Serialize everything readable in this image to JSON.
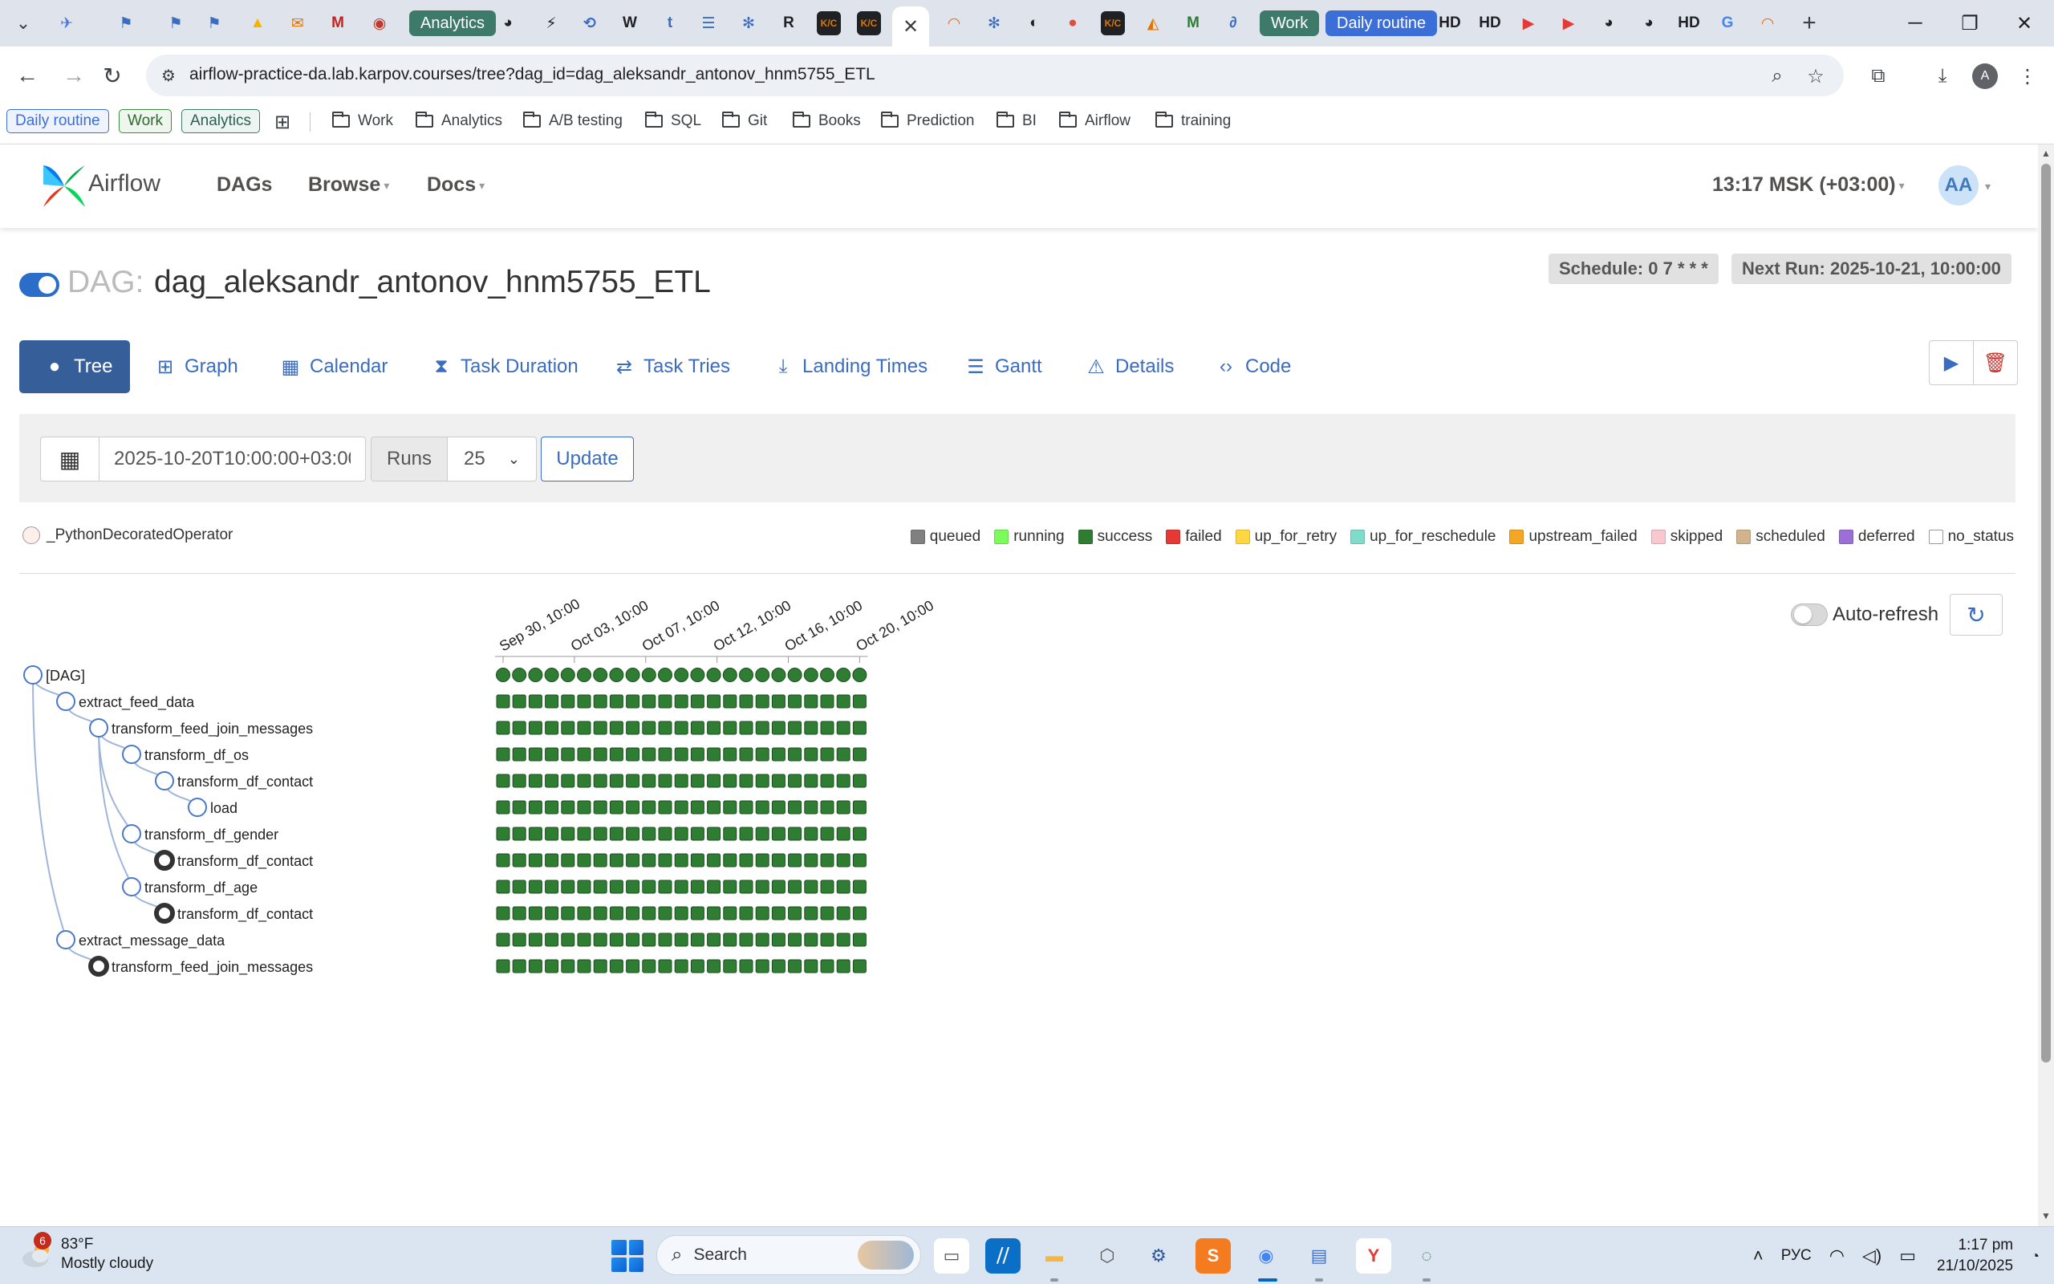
{
  "browser": {
    "tabs_pills": [
      {
        "label": "Analytics",
        "color": "#3d7a6a"
      },
      {
        "label": "Work",
        "color": "#3d7a6a"
      },
      {
        "label": "Daily routine",
        "color": "#3b6ed6"
      }
    ],
    "tab_badges": [
      "HD",
      "HD",
      "HD"
    ],
    "address": "airflow-practice-da.lab.karpov.courses/tree?dag_id=dag_aleksandr_antonov_hnm5755_ETL",
    "profile_initial": "A"
  },
  "bookmarks": {
    "badges": [
      {
        "label": "Daily routine",
        "color": "#3b6ed6"
      },
      {
        "label": "Work",
        "color": "#3d8a3d"
      },
      {
        "label": "Analytics",
        "color": "#3d7a6a"
      }
    ],
    "folders": [
      "Work",
      "Analytics",
      "A/B testing",
      "SQL",
      "Git",
      "Books",
      "Prediction",
      "BI",
      "Airflow",
      "training"
    ]
  },
  "airflow": {
    "brand": "Airflow",
    "menu": [
      "DAGs",
      "Browse",
      "Docs"
    ],
    "clock": "13:17 MSK (+03:00)",
    "user_initials": "AA",
    "dag_prefix": "DAG:",
    "dag_id": "dag_aleksandr_antonov_hnm5755_ETL",
    "schedule": "Schedule: 0 7 * * *",
    "next_run": "Next Run: 2025-10-21, 10:00:00",
    "views": [
      "Tree",
      "Graph",
      "Calendar",
      "Task Duration",
      "Task Tries",
      "Landing Times",
      "Gantt",
      "Details",
      "Code"
    ],
    "base_date": "2025-10-20T10:00:00+03:00",
    "runs_label": "Runs",
    "runs_value": "25",
    "update_label": "Update",
    "operator_legend": "_PythonDecoratedOperator",
    "states": [
      {
        "label": "queued",
        "color": "#808080"
      },
      {
        "label": "running",
        "color": "#7cfc5c"
      },
      {
        "label": "success",
        "color": "#2e7d32"
      },
      {
        "label": "failed",
        "color": "#e53935"
      },
      {
        "label": "up_for_retry",
        "color": "#ffd740"
      },
      {
        "label": "up_for_reschedule",
        "color": "#7fdccb"
      },
      {
        "label": "upstream_failed",
        "color": "#f5a623"
      },
      {
        "label": "skipped",
        "color": "#f8c8d0"
      },
      {
        "label": "scheduled",
        "color": "#d2b48c"
      },
      {
        "label": "deferred",
        "color": "#9b6fd6"
      },
      {
        "label": "no_status",
        "color": "#ffffff"
      }
    ],
    "auto_refresh_label": "Auto-refresh",
    "date_labels": [
      "Sep 30, 10:00",
      "Oct 03, 10:00",
      "Oct 07, 10:00",
      "Oct 12, 10:00",
      "Oct 16, 10:00",
      "Oct 20, 10:00"
    ],
    "run_count": 23,
    "run_status": "success",
    "tasks": [
      {
        "name": "[DAG]",
        "depth": 0,
        "parent": null,
        "kind": "dag"
      },
      {
        "name": "extract_feed_data",
        "depth": 1,
        "parent": 0,
        "kind": "task"
      },
      {
        "name": "transform_feed_join_messages",
        "depth": 2,
        "parent": 1,
        "kind": "task"
      },
      {
        "name": "transform_df_os",
        "depth": 3,
        "parent": 2,
        "kind": "task"
      },
      {
        "name": "transform_df_contact",
        "depth": 4,
        "parent": 3,
        "kind": "task"
      },
      {
        "name": "load",
        "depth": 5,
        "parent": 4,
        "kind": "task"
      },
      {
        "name": "transform_df_gender",
        "depth": 3,
        "parent": 2,
        "kind": "task"
      },
      {
        "name": "transform_df_contact",
        "depth": 4,
        "parent": 6,
        "kind": "ref"
      },
      {
        "name": "transform_df_age",
        "depth": 3,
        "parent": 2,
        "kind": "task"
      },
      {
        "name": "transform_df_contact",
        "depth": 4,
        "parent": 8,
        "kind": "ref"
      },
      {
        "name": "extract_message_data",
        "depth": 1,
        "parent": 0,
        "kind": "task"
      },
      {
        "name": "transform_feed_join_messages",
        "depth": 2,
        "parent": 10,
        "kind": "ref"
      }
    ]
  },
  "taskbar": {
    "weather_badge": "6",
    "weather_temp": "83°F",
    "weather_desc": "Mostly cloudy",
    "search_label": "Search",
    "language": "РУС",
    "time": "1:17 pm",
    "date": "21/10/2025"
  }
}
